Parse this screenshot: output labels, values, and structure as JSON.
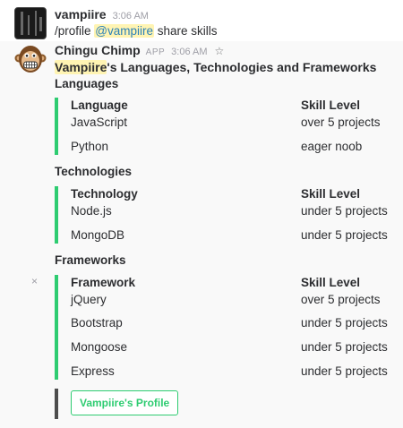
{
  "message1": {
    "username": "vampiire",
    "time": "3:06 AM",
    "command": "/profile",
    "mention": "@vampiire",
    "rest": "share skills"
  },
  "message2": {
    "username": "Chingu Chimp",
    "badge": "APP",
    "time": "3:06 AM",
    "star_icon": "star-icon",
    "title_highlight": "Vampiire",
    "title_rest": "'s Languages, Technologies and Frameworks",
    "sections": [
      {
        "title": "Languages",
        "col1_header": "Language",
        "col2_header": "Skill Level",
        "rows": [
          {
            "name": "JavaScript",
            "level": "over 5 projects"
          },
          {
            "name": "Python",
            "level": "eager noob"
          }
        ]
      },
      {
        "title": "Technologies",
        "col1_header": "Technology",
        "col2_header": "Skill Level",
        "rows": [
          {
            "name": "Node.js",
            "level": "under 5 projects"
          },
          {
            "name": "MongoDB",
            "level": "under 5 projects"
          }
        ]
      },
      {
        "title": "Frameworks",
        "col1_header": "Framework",
        "col2_header": "Skill Level",
        "rows": [
          {
            "name": "jQuery",
            "level": "over 5 projects"
          },
          {
            "name": "Bootstrap",
            "level": "under 5 projects"
          },
          {
            "name": "Mongoose",
            "level": "under 5 projects"
          },
          {
            "name": "Express",
            "level": "under 5 projects"
          }
        ]
      }
    ],
    "close_glyph": "×",
    "profile_button": "Vampiire's Profile"
  },
  "colors": {
    "attachment_green": "#2ecc71",
    "attachment_grey": "#4d4d4d",
    "mention_blue": "#2a80b9",
    "highlight_yellow": "#fff4b3"
  }
}
